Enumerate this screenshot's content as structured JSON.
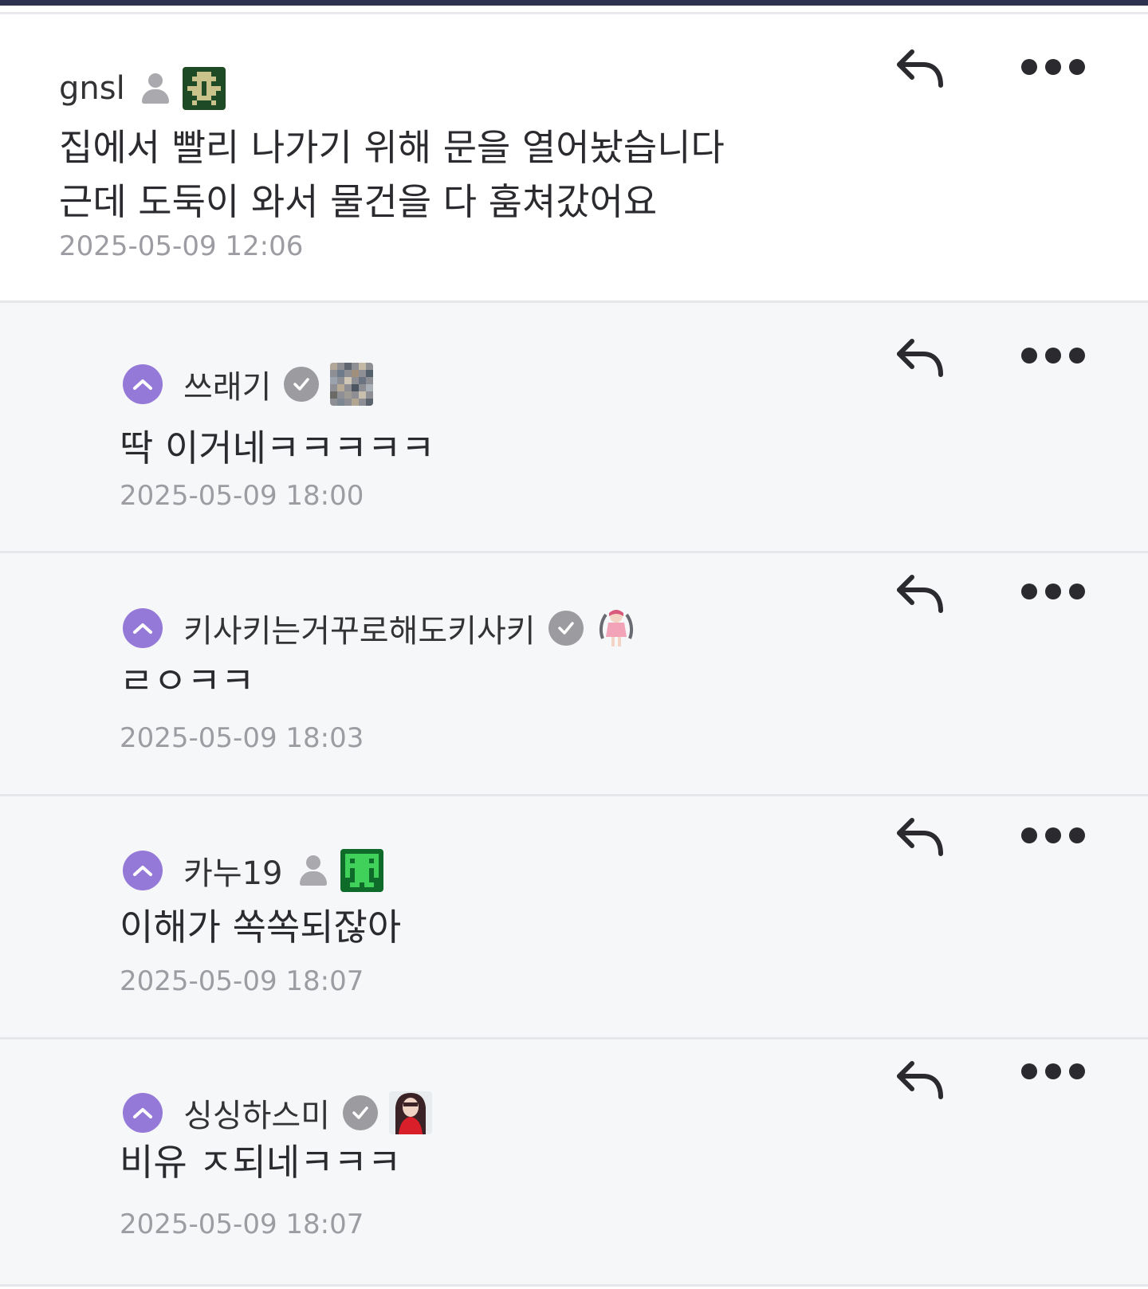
{
  "comments": [
    {
      "author": "gnsl",
      "badge": "user-icon",
      "text": "집에서 빨리 나가기 위해 문을 열어놨습니다\n근데 도둑이 와서 물건을 다 훔쳐갔어요",
      "timestamp": "2025-05-09 12:06"
    },
    {
      "author": "쓰래기",
      "badge": "verified-icon",
      "text": "딱 이거네ㅋㅋㅋㅋㅋ",
      "timestamp": "2025-05-09 18:00"
    },
    {
      "author": "키사키는거꾸로해도키사키",
      "badge": "verified-icon",
      "text": "ㄹㅇㅋㅋ",
      "timestamp": "2025-05-09 18:03"
    },
    {
      "author": "카누19",
      "badge": "user-icon",
      "text": "이해가 쏙쏙되잖아",
      "timestamp": "2025-05-09 18:07"
    },
    {
      "author": "싱싱하스미",
      "badge": "verified-icon",
      "text": "비유 ㅈ되네ㅋㅋㅋ",
      "timestamp": "2025-05-09 18:07"
    }
  ],
  "colors": {
    "collapse_accent": "#9479d8",
    "timestamp": "#9c9ca2",
    "reply_background": "#f6f7f9",
    "header_bar": "#2e3150"
  }
}
